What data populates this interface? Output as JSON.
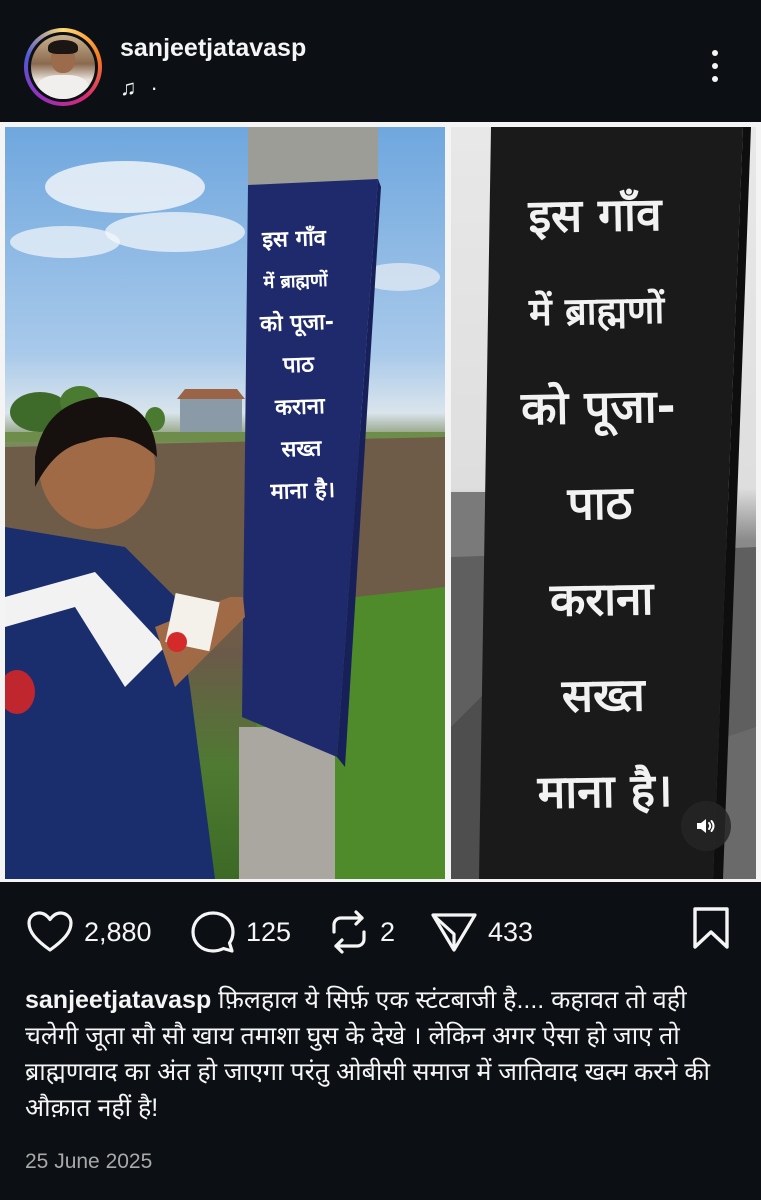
{
  "header": {
    "username": "sanjeetjatavasp",
    "audio_icon": "music-note-icon",
    "audio_separator": "·",
    "more_icon": "more-vertical-icon"
  },
  "media": {
    "left_sign_lines": [
      "इस गाँव",
      "में ब्राह्मणों",
      "को पूजा-",
      "पाठ",
      "कराना",
      "सख्त",
      "माना है।"
    ],
    "right_sign_lines": [
      "इस गाँव",
      "में ब्राह्मणों",
      "को पूजा-",
      "पाठ",
      "कराना",
      "सख्त",
      "माना है।"
    ],
    "audio_icon": "speaker-icon"
  },
  "actions": {
    "likes": "2,880",
    "comments": "125",
    "reposts": "2",
    "shares": "433",
    "icons": [
      "heart-icon",
      "comment-icon",
      "repost-icon",
      "send-icon",
      "bookmark-icon"
    ]
  },
  "caption": {
    "username": "sanjeetjatavasp",
    "text": "फ़िलहाल ये सिर्फ़ एक स्टंटबाजी है.... कहावत तो वही चलेगी जूता सौ सौ खाय तमाशा घुस के देखे । लेकिन अगर ऐसा हो जाए तो ब्राह्मणवाद का अंत हो जाएगा परंतु ओबीसी समाज में जातिवाद खत्म करने की औक़ात नहीं है!"
  },
  "date": "25 June 2025"
}
